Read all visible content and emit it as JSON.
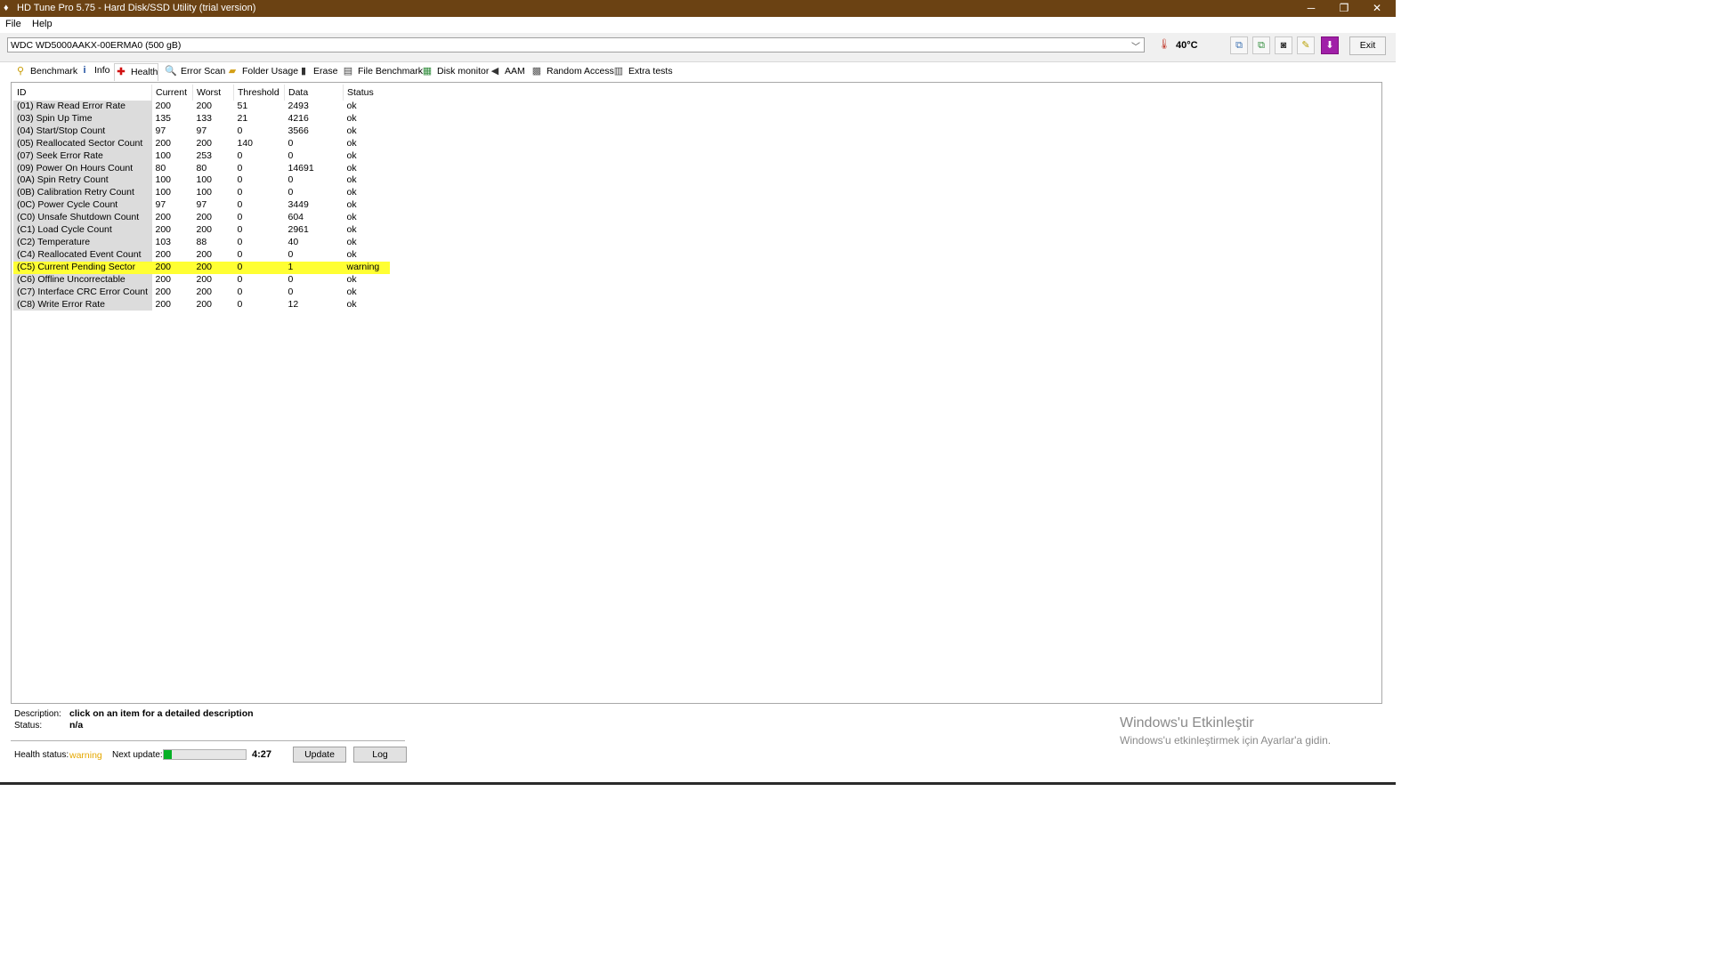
{
  "window": {
    "title": "HD Tune Pro 5.75 - Hard Disk/SSD Utility (trial version)",
    "minimize": "─",
    "restore": "❐",
    "close": "✕"
  },
  "menu": [
    "File",
    "Help"
  ],
  "toolbar": {
    "drive": "WDC WD5000AAKX-00ERMA0 (500 gB)",
    "temperature": "40°C",
    "exit_label": "Exit",
    "thermometer_icon": "thermometer-icon"
  },
  "tabs": [
    {
      "label": "Benchmark",
      "icon": "benchmark-icon"
    },
    {
      "label": "Info",
      "icon": "info-icon"
    },
    {
      "label": "Health",
      "icon": "health-cross-icon"
    },
    {
      "label": "Error Scan",
      "icon": "magnifier-icon"
    },
    {
      "label": "Folder Usage",
      "icon": "folder-icon"
    },
    {
      "label": "Erase",
      "icon": "trash-icon"
    },
    {
      "label": "File Benchmark",
      "icon": "file-benchmark-icon"
    },
    {
      "label": "Disk monitor",
      "icon": "disk-monitor-icon"
    },
    {
      "label": "AAM",
      "icon": "speaker-icon"
    },
    {
      "label": "Random Access",
      "icon": "random-access-icon"
    },
    {
      "label": "Extra tests",
      "icon": "extra-tests-icon"
    }
  ],
  "table": {
    "headers": [
      "ID",
      "Current",
      "Worst",
      "Threshold",
      "Data",
      "Status"
    ],
    "rows": [
      {
        "id": "(01) Raw Read Error Rate",
        "current": "200",
        "worst": "200",
        "threshold": "51",
        "data": "2493",
        "status": "ok"
      },
      {
        "id": "(03) Spin Up Time",
        "current": "135",
        "worst": "133",
        "threshold": "21",
        "data": "4216",
        "status": "ok"
      },
      {
        "id": "(04) Start/Stop Count",
        "current": "97",
        "worst": "97",
        "threshold": "0",
        "data": "3566",
        "status": "ok"
      },
      {
        "id": "(05) Reallocated Sector Count",
        "current": "200",
        "worst": "200",
        "threshold": "140",
        "data": "0",
        "status": "ok"
      },
      {
        "id": "(07) Seek Error Rate",
        "current": "100",
        "worst": "253",
        "threshold": "0",
        "data": "0",
        "status": "ok"
      },
      {
        "id": "(09) Power On Hours Count",
        "current": "80",
        "worst": "80",
        "threshold": "0",
        "data": "14691",
        "status": "ok"
      },
      {
        "id": "(0A) Spin Retry Count",
        "current": "100",
        "worst": "100",
        "threshold": "0",
        "data": "0",
        "status": "ok"
      },
      {
        "id": "(0B) Calibration Retry Count",
        "current": "100",
        "worst": "100",
        "threshold": "0",
        "data": "0",
        "status": "ok"
      },
      {
        "id": "(0C) Power Cycle Count",
        "current": "97",
        "worst": "97",
        "threshold": "0",
        "data": "3449",
        "status": "ok"
      },
      {
        "id": "(C0) Unsafe Shutdown Count",
        "current": "200",
        "worst": "200",
        "threshold": "0",
        "data": "604",
        "status": "ok"
      },
      {
        "id": "(C1) Load Cycle Count",
        "current": "200",
        "worst": "200",
        "threshold": "0",
        "data": "2961",
        "status": "ok"
      },
      {
        "id": "(C2) Temperature",
        "current": "103",
        "worst": "88",
        "threshold": "0",
        "data": "40",
        "status": "ok"
      },
      {
        "id": "(C4) Reallocated Event Count",
        "current": "200",
        "worst": "200",
        "threshold": "0",
        "data": "0",
        "status": "ok"
      },
      {
        "id": "(C5) Current Pending Sector",
        "current": "200",
        "worst": "200",
        "threshold": "0",
        "data": "1",
        "status": "warning"
      },
      {
        "id": "(C6) Offline Uncorrectable",
        "current": "200",
        "worst": "200",
        "threshold": "0",
        "data": "0",
        "status": "ok"
      },
      {
        "id": "(C7) Interface CRC Error Count",
        "current": "200",
        "worst": "200",
        "threshold": "0",
        "data": "0",
        "status": "ok"
      },
      {
        "id": "(C8) Write Error Rate",
        "current": "200",
        "worst": "200",
        "threshold": "0",
        "data": "12",
        "status": "ok"
      }
    ]
  },
  "description": {
    "label": "Description:",
    "value": "click on an item for a detailed description",
    "status_label": "Status:",
    "status_value": "n/a"
  },
  "health": {
    "label": "Health status:",
    "value": "warning",
    "value_color": "#e5a800",
    "next_update_label": "Next update:",
    "progress": 0.1,
    "time": "4:27",
    "update_label": "Update",
    "log_label": "Log"
  },
  "watermark": {
    "line1": "Windows'u Etkinleştir",
    "line2": "Windows'u etkinleştirmek için Ayarlar'a gidin."
  }
}
